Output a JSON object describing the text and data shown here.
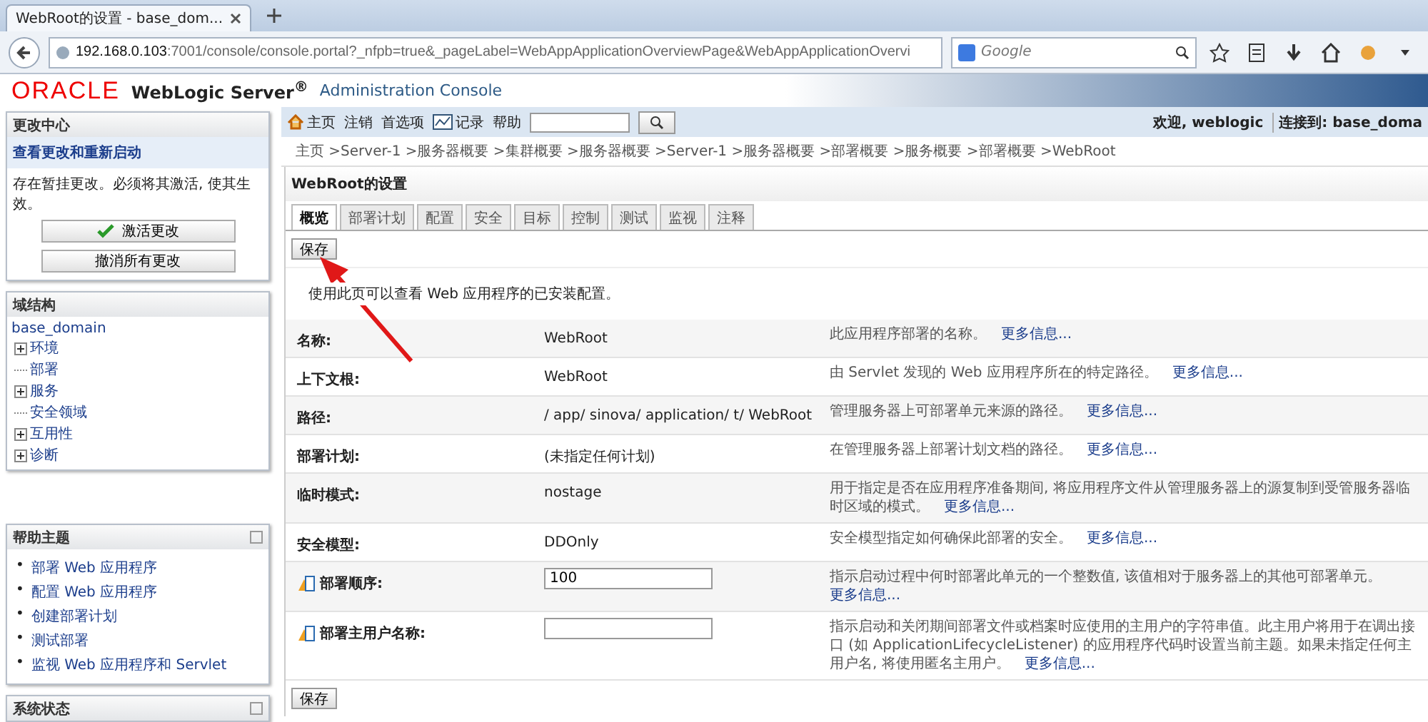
{
  "browser": {
    "tab_title": "WebRoot的设置 - base_dom...",
    "url_host": "192.168.0.103",
    "url_rest": ":7001/console/console.portal?_nfpb=true&_pageLabel=WebAppApplicationOverviewPage&WebAppApplicationOvervi",
    "search_placeholder": "Google"
  },
  "header": {
    "logo": "ORACLE",
    "product": "WebLogic Server$^{®}$",
    "subtitle": "Administration Console"
  },
  "toolbar": {
    "items": [
      {
        "kind": "home",
        "label": "主页"
      },
      {
        "kind": "plain",
        "label": "注销"
      },
      {
        "kind": "plain",
        "label": "首选项"
      },
      {
        "kind": "chart",
        "label": "记录"
      },
      {
        "kind": "plain",
        "label": "帮助"
      }
    ],
    "welcome": "欢迎, weblogic",
    "connected": "连接到: base_doma"
  },
  "breadcrumb": "主页 >Server-1 >服务器概要 >集群概要 >服务器概要 >Server-1 >服务器概要 >部署概要 >服务概要 >部署概要 >WebRoot",
  "change_center": {
    "title": "更改中心",
    "link": "查看更改和重新启动",
    "message": "存在暂挂更改。必须将其激活, 使其生效。",
    "activate": "激活更改",
    "undo": "撤消所有更改"
  },
  "domain_structure": {
    "title": "域结构",
    "root": "base_domain",
    "children": [
      {
        "label": "环境",
        "expandable": true
      },
      {
        "label": "部署",
        "expandable": false
      },
      {
        "label": "服务",
        "expandable": true
      },
      {
        "label": "安全领域",
        "expandable": false
      },
      {
        "label": "互用性",
        "expandable": true
      },
      {
        "label": "诊断",
        "expandable": true
      }
    ]
  },
  "help_topics": {
    "title": "帮助主题",
    "bullet": "•",
    "items": [
      "部署 Web 应用程序",
      "配置 Web 应用程序",
      "创建部署计划",
      "测试部署",
      "监视 Web 应用程序和 Servlet"
    ]
  },
  "system_status": {
    "title": "系统状态"
  },
  "page": {
    "title": "WebRoot的设置",
    "tabs": [
      {
        "label": "概览",
        "selected": true
      },
      {
        "label": "部署计划",
        "selected": false
      },
      {
        "label": "配置",
        "selected": false
      },
      {
        "label": "安全",
        "selected": false
      },
      {
        "label": "目标",
        "selected": false
      },
      {
        "label": "控制",
        "selected": false
      },
      {
        "label": "测试",
        "selected": false
      },
      {
        "label": "监视",
        "selected": false
      },
      {
        "label": "注释",
        "selected": false
      }
    ],
    "save": "保存",
    "description": "使用此页可以查看 Web 应用程序的已安装配置。",
    "rows": [
      {
        "kind": "text",
        "label": "名称:",
        "value": "WebRoot",
        "help": "此应用程序部署的名称。",
        "more": "更多信息..."
      },
      {
        "kind": "text",
        "label": "上下文根:",
        "value": "WebRoot",
        "help": "由 Servlet 发现的 Web 应用程序所在的特定路径。",
        "more": "更多信息..."
      },
      {
        "kind": "text",
        "label": "路径:",
        "value": "/ app/ sinova/ application/ t/ WebRoot",
        "help": "管理服务器上可部署单元来源的路径。",
        "more": "更多信息..."
      },
      {
        "kind": "text",
        "label": "部署计划:",
        "value": "(未指定任何计划)",
        "help": "在管理服务器上部署计划文档的路径。",
        "more": "更多信息..."
      },
      {
        "kind": "text",
        "label": "临时模式:",
        "value": "nostage",
        "help": "用于指定是否在应用程序准备期间, 将应用程序文件从管理服务器上的源复制到受管服务器临时区域的模式。",
        "more": "更多信息..."
      },
      {
        "kind": "text",
        "label": "安全模型:",
        "value": "DDOnly",
        "help": "安全模型指定如何确保此部署的安全。",
        "more": "更多信息..."
      },
      {
        "kind": "input",
        "label": "部署顺序:",
        "value": "100",
        "help": "指示启动过程中何时部署此单元的一个整数值, 该值相对于服务器上的其他可部署单元。",
        "more": "更多信息..."
      },
      {
        "kind": "input",
        "label": "部署主用户名称:",
        "help": "指示启动和关闭期间部署文件或档案时应使用的主用户的字符串值。此主用户将用于在调出接口 (如 ApplicationLifecycleListener) 的应用程序代码时设置当前主题。如果未指定任何主用户名, 将使用匿名主用户。",
        "more": "更多信息..."
      }
    ],
    "save_bottom": "保存"
  }
}
